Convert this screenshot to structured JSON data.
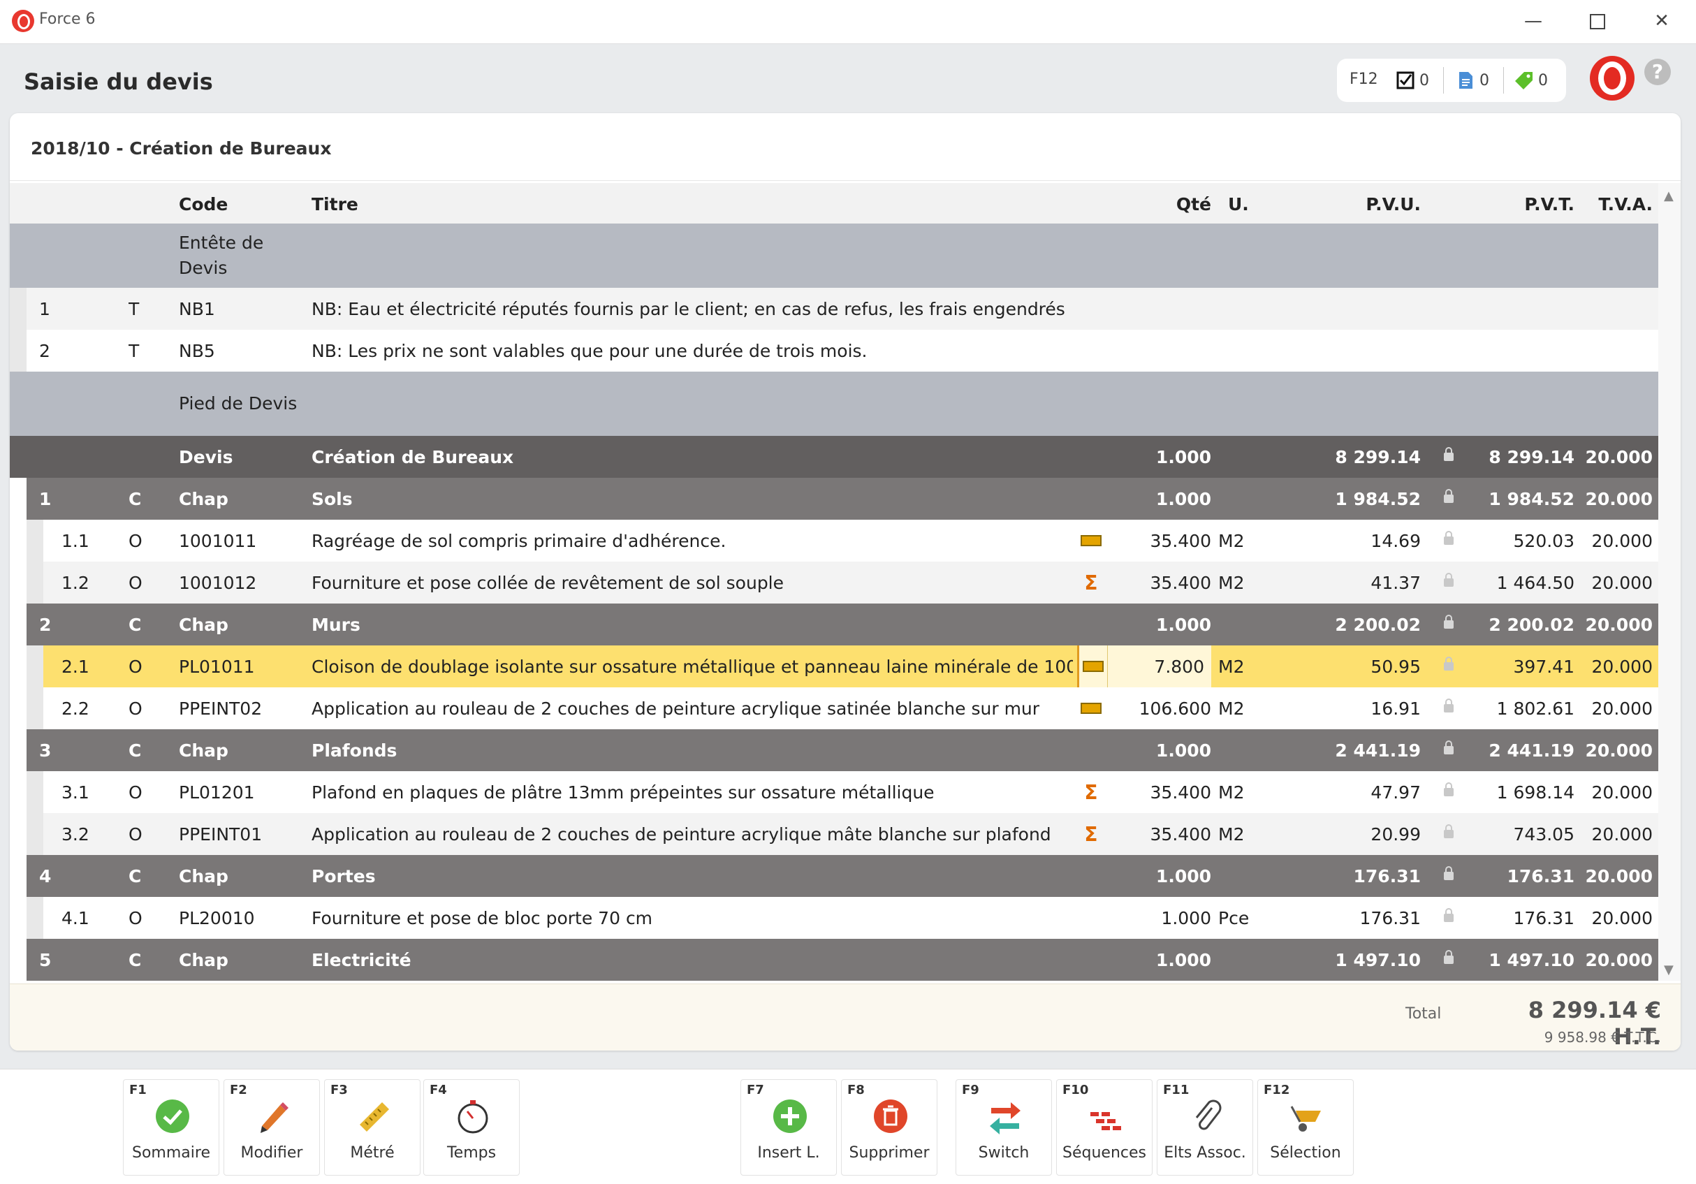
{
  "window": {
    "app_title": "Force 6"
  },
  "header": {
    "page_title": "Saisie du devis",
    "f12_label": "F12",
    "counters": {
      "tasks": "0",
      "documents": "0",
      "tags": "0"
    },
    "help": "?"
  },
  "project": {
    "title": "2018/10 - Création de Bureaux"
  },
  "table": {
    "headers": {
      "code": "Code",
      "titre": "Titre",
      "qte": "Qté",
      "unit": "U.",
      "pvu": "P.V.U.",
      "pvt": "P.V.T.",
      "tva": "T.V.A."
    },
    "rows": [
      {
        "kind": "section",
        "num": "",
        "type": "",
        "code": "Entête de Devis",
        "title": "",
        "mark": "",
        "qty": "",
        "unit": "",
        "pvu": "",
        "lock": false,
        "pvt": "",
        "tva": ""
      },
      {
        "kind": "note",
        "num": "1",
        "type": "T",
        "code": "NB1",
        "title": "NB: Eau et électricité réputés fournis par le client; en cas de refus, les frais engendrés",
        "mark": "",
        "qty": "",
        "unit": "",
        "pvu": "",
        "lock": false,
        "pvt": "",
        "tva": ""
      },
      {
        "kind": "note2",
        "num": "2",
        "type": "T",
        "code": "NB5",
        "title": "NB: Les prix ne sont valables que pour une durée de trois mois.",
        "mark": "",
        "qty": "",
        "unit": "",
        "pvu": "",
        "lock": false,
        "pvt": "",
        "tva": ""
      },
      {
        "kind": "section",
        "num": "",
        "type": "",
        "code": "Pied de Devis",
        "title": "",
        "mark": "",
        "qty": "",
        "unit": "",
        "pvu": "",
        "lock": false,
        "pvt": "",
        "tva": ""
      },
      {
        "kind": "devis",
        "num": "",
        "type": "",
        "code": "Devis",
        "title": "Création de Bureaux",
        "mark": "",
        "qty": "1.000",
        "unit": "",
        "pvu": "8 299.14",
        "lock": true,
        "pvt": "8 299.14",
        "tva": "20.000"
      },
      {
        "kind": "chap",
        "num": "1",
        "type": "C",
        "code": "Chap",
        "title": "Sols",
        "mark": "",
        "qty": "1.000",
        "unit": "",
        "pvu": "1 984.52",
        "lock": true,
        "pvt": "1 984.52",
        "tva": "20.000"
      },
      {
        "kind": "item",
        "num": "1.1",
        "type": "O",
        "code": "1001011",
        "title": "Ragréage de sol compris primaire d'adhérence.",
        "mark": "ruler",
        "qty": "35.400",
        "unit": "M2",
        "pvu": "14.69",
        "lock": true,
        "pvt": "520.03",
        "tva": "20.000"
      },
      {
        "kind": "item-alt",
        "num": "1.2",
        "type": "O",
        "code": "1001012",
        "title": "Fourniture et pose collée de revêtement de sol souple",
        "mark": "sigma",
        "qty": "35.400",
        "unit": "M2",
        "pvu": "41.37",
        "lock": true,
        "pvt": "1 464.50",
        "tva": "20.000"
      },
      {
        "kind": "chap",
        "num": "2",
        "type": "C",
        "code": "Chap",
        "title": "Murs",
        "mark": "",
        "qty": "1.000",
        "unit": "",
        "pvu": "2 200.02",
        "lock": true,
        "pvt": "2 200.02",
        "tva": "20.000"
      },
      {
        "kind": "selected",
        "num": "2.1",
        "type": "O",
        "code": "PL01011",
        "title": "Cloison de doublage isolante sur ossature métallique et panneau laine minérale de 100",
        "mark": "ruler",
        "qty": "7.800",
        "unit": "M2",
        "pvu": "50.95",
        "lock": true,
        "pvt": "397.41",
        "tva": "20.000"
      },
      {
        "kind": "item",
        "num": "2.2",
        "type": "O",
        "code": "PPEINT02",
        "title": "Application au rouleau de 2 couches de peinture acrylique satinée blanche sur mur",
        "mark": "ruler",
        "qty": "106.600",
        "unit": "M2",
        "pvu": "16.91",
        "lock": true,
        "pvt": "1 802.61",
        "tva": "20.000"
      },
      {
        "kind": "chap",
        "num": "3",
        "type": "C",
        "code": "Chap",
        "title": "Plafonds",
        "mark": "",
        "qty": "1.000",
        "unit": "",
        "pvu": "2 441.19",
        "lock": true,
        "pvt": "2 441.19",
        "tva": "20.000"
      },
      {
        "kind": "item",
        "num": "3.1",
        "type": "O",
        "code": "PL01201",
        "title": "Plafond en plaques de plâtre 13mm prépeintes sur ossature métallique",
        "mark": "sigma",
        "qty": "35.400",
        "unit": "M2",
        "pvu": "47.97",
        "lock": true,
        "pvt": "1 698.14",
        "tva": "20.000"
      },
      {
        "kind": "item-alt",
        "num": "3.2",
        "type": "O",
        "code": "PPEINT01",
        "title": "Application au rouleau de 2 couches de peinture acrylique mâte blanche sur plafond",
        "mark": "sigma",
        "qty": "35.400",
        "unit": "M2",
        "pvu": "20.99",
        "lock": true,
        "pvt": "743.05",
        "tva": "20.000"
      },
      {
        "kind": "chap",
        "num": "4",
        "type": "C",
        "code": "Chap",
        "title": "Portes",
        "mark": "",
        "qty": "1.000",
        "unit": "",
        "pvu": "176.31",
        "lock": true,
        "pvt": "176.31",
        "tva": "20.000"
      },
      {
        "kind": "item",
        "num": "4.1",
        "type": "O",
        "code": "PL20010",
        "title": "Fourniture et pose de bloc porte 70 cm",
        "mark": "",
        "qty": "1.000",
        "unit": "Pce",
        "pvu": "176.31",
        "lock": true,
        "pvt": "176.31",
        "tva": "20.000"
      },
      {
        "kind": "chap",
        "num": "5",
        "type": "C",
        "code": "Chap",
        "title": "Electricité",
        "mark": "",
        "qty": "1.000",
        "unit": "",
        "pvu": "1 497.10",
        "lock": true,
        "pvt": "1 497.10",
        "tva": "20.000"
      }
    ]
  },
  "totals": {
    "label": "Total",
    "ht": "8 299.14 € H.T.",
    "ttc": "9 958.98 € T.T.C."
  },
  "toolbar": {
    "buttons": [
      {
        "key": "F1",
        "label": "Sommaire",
        "icon": "check-circle-icon"
      },
      {
        "key": "F2",
        "label": "Modifier",
        "icon": "pencil-icon"
      },
      {
        "key": "F3",
        "label": "Métré",
        "icon": "ruler-icon"
      },
      {
        "key": "F4",
        "label": "Temps",
        "icon": "stopwatch-icon"
      },
      {
        "key": "F7",
        "label": "Insert L.",
        "icon": "plus-circle-icon"
      },
      {
        "key": "F8",
        "label": "Supprimer",
        "icon": "trash-icon"
      },
      {
        "key": "F9",
        "label": "Switch",
        "icon": "switch-arrows-icon"
      },
      {
        "key": "F10",
        "label": "Séquences",
        "icon": "bricks-icon"
      },
      {
        "key": "F11",
        "label": "Elts Assoc.",
        "icon": "paperclip-icon"
      },
      {
        "key": "F12",
        "label": "Sélection",
        "icon": "wheelbarrow-icon"
      }
    ]
  },
  "colors": {
    "accent_red": "#e32b22",
    "selected_row": "#fde06f",
    "chapter_row": "#7a7777",
    "devis_row": "#625f5f",
    "section_row": "#b6bac2"
  }
}
